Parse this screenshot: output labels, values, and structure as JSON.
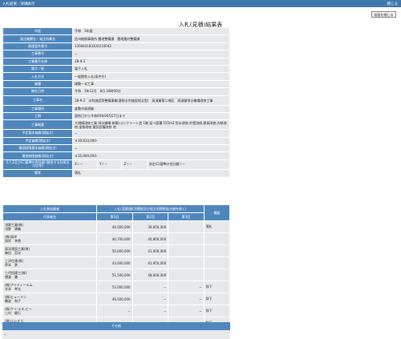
{
  "header": {
    "title": "入札結果／詳細表示",
    "right": "閉じる"
  },
  "close_button": "画面を閉じる",
  "page_title": "入札(見積)結果表",
  "info_rows": [
    {
      "k": "年度",
      "v": "令和　3年度"
    },
    {
      "k": "発注機関名／発注所属名",
      "v": "信州総務事務所 農地整備課　農地農村整備課"
    },
    {
      "k": "調達案件番号",
      "v": "330083183320210042"
    },
    {
      "k": "工事番号",
      "v": "−"
    },
    {
      "k": "工事番号名称",
      "v": "2B-9-2"
    },
    {
      "k": "電子／紙",
      "v": "電子入札"
    },
    {
      "k": "入札方式",
      "v": "一般競争入札(条件付)"
    },
    {
      "k": "業種",
      "v": "建築一式工事"
    },
    {
      "k": "開札日時",
      "v": "令和　3年12月　8日 16時00分"
    },
    {
      "k": "工事名",
      "v": "2B-9-2　水利施設等整備事業(基幹水利施設保全型)　高須賀第二地区　高須賀排水機場改修工事"
    },
    {
      "k": "工事場所",
      "v": "倉敷市高須賀"
    },
    {
      "k": "工期",
      "v": "契約日から令和04年06月27日まで"
    },
    {
      "k": "工事概要",
      "v": "大規模改修工事 排水機場 新築(コンクリート造 1階 延べ面積 155m2 防水改修,外壁改修,建具改修,内装改修,塗装改修,電気設備改修 他"
    },
    {
      "k": "予定基本価格(税抜き)",
      "v": "−"
    },
    {
      "k": "予定価格(税抜き)",
      "v": "￥39,810,000-"
    },
    {
      "k": "最低制限基本価格(税抜き)",
      "v": "−"
    },
    {
      "k": "最低制限価格(税抜き)",
      "v": "￥35,900,000-"
    }
  ],
  "xyz_row": {
    "k": "X,Y,Z及び(C)基準の合計額\n(総合する技術点の比率)",
    "x": "X＝−",
    "y": "Y＝−",
    "z": "Z＝−",
    "c": "決定(C)基準の合計額＝−"
  },
  "remarks_row": {
    "k": "備考",
    "v": "落札"
  },
  "bid_table": {
    "head_name": "入札参加業者",
    "head_group": "入札(見積)額(消費税及び地方消費税抜き額を除く)",
    "head_remark": "摘要",
    "sub_name": "代表者名",
    "rounds": [
      "第1回",
      "第2回",
      "第3回"
    ],
    "rows": [
      {
        "company": "浅野工業(株)",
        "rep": "浅野　康義",
        "r1": "44,000,000",
        "r2": "39,600,000",
        "r3": "",
        "remark": "落札"
      },
      {
        "company": "(株)高岸",
        "rep": "高岸　幸德",
        "r1": "46,700,000",
        "r2": "40,800,000",
        "r3": "",
        "remark": ""
      },
      {
        "company": "東洋建設工業(株)",
        "rep": "森田　哲次",
        "r1": "50,000,000",
        "r2": "41,000,000",
        "r3": "",
        "remark": ""
      },
      {
        "company": "三洋住建(株)",
        "rep": "草本　勇",
        "r1": "43,000,000",
        "r2": "41,950,000",
        "r3": "",
        "remark": ""
      },
      {
        "company": "三代田建工(株)",
        "rep": "樋渡　肇",
        "r1": "51,500,000",
        "r2": "48,000,000",
        "r3": "",
        "remark": ""
      },
      {
        "company": "(株)アイティーエム",
        "rep": "木本　孝光",
        "r1": "53,000,000",
        "r2": "−",
        "r3": "−",
        "remark": "辞下"
      },
      {
        "company": "(株)ヒューマン",
        "rep": "難波　和子",
        "r1": "49,500,000",
        "r2": "−",
        "r3": "−",
        "remark": "辞下"
      },
      {
        "company": "(株)ケイ.エス.ビー",
        "rep": "三村　慶行",
        "r1": "−",
        "r2": "−",
        "r3": "−",
        "remark": "辞下"
      },
      {
        "company": "(株)ニシオカ",
        "rep": "西岡　貞和",
        "r1": "−",
        "r2": "−",
        "r3": "−",
        "remark": "辞下"
      }
    ]
  },
  "other": {
    "title": "その他",
    "body": "−"
  }
}
